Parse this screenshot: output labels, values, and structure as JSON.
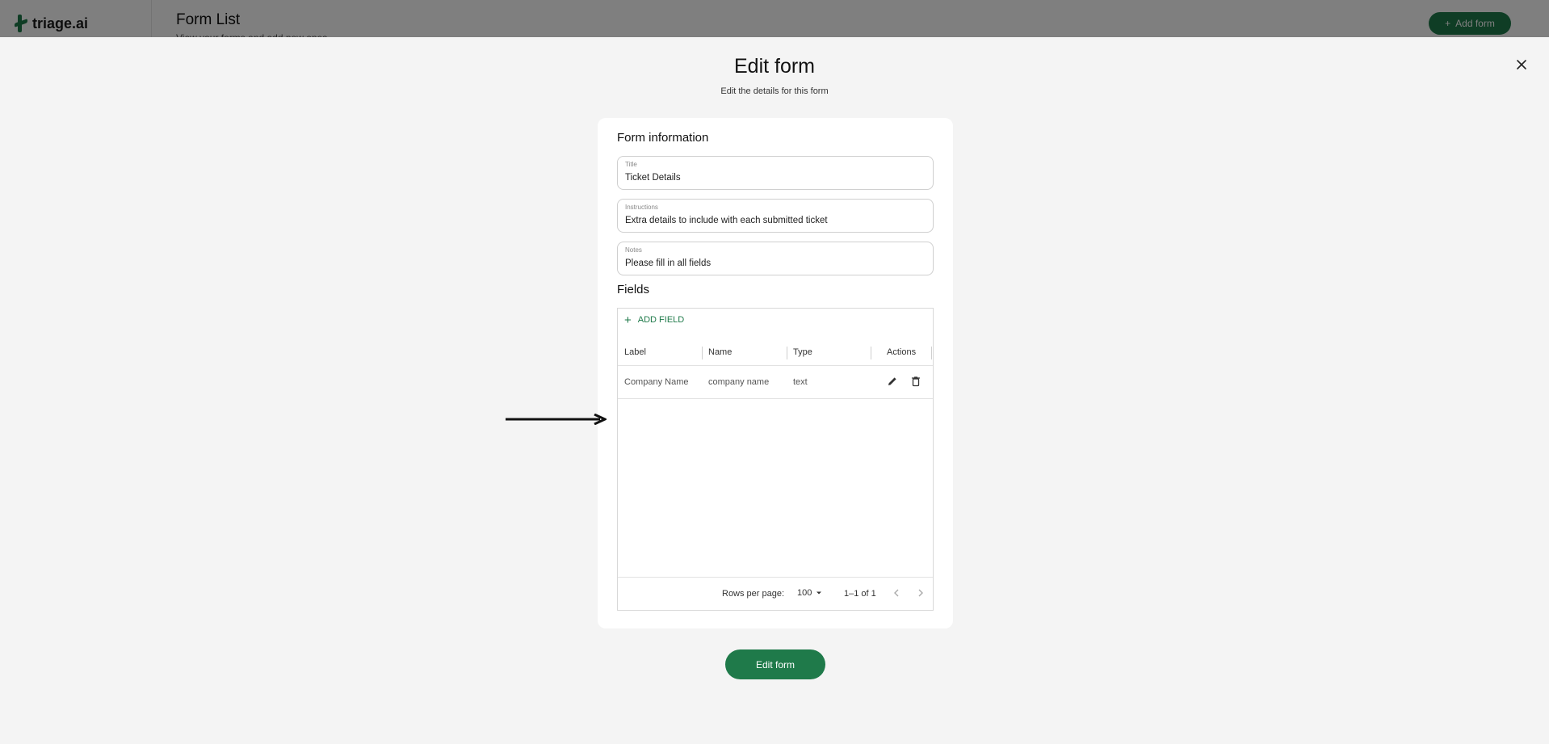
{
  "app": {
    "logo_text": "triage.ai",
    "page_title": "Form List",
    "page_subtitle": "View your forms and add new ones",
    "add_form_label": "Add form"
  },
  "modal": {
    "title": "Edit form",
    "subtitle": "Edit the details for this form",
    "form_info_heading": "Form information",
    "inputs": {
      "title": {
        "label": "Title",
        "value": "Ticket Details"
      },
      "instructions": {
        "label": "Instructions",
        "value": "Extra details to include with each submitted ticket"
      },
      "notes": {
        "label": "Notes",
        "value": "Please fill in all fields"
      }
    },
    "fields_heading": "Fields",
    "add_field_label": "ADD FIELD",
    "columns": {
      "label": "Label",
      "name": "Name",
      "type": "Type",
      "actions": "Actions"
    },
    "rows": [
      {
        "label": "Company Name",
        "name": "company name",
        "type": "text"
      }
    ],
    "pagination": {
      "rows_per_page_label": "Rows per page:",
      "rows_per_page_value": "100",
      "range": "1–1 of 1"
    },
    "submit_label": "Edit form"
  },
  "icons": {
    "close": "close-icon",
    "plus": "plus-icon",
    "edit": "pencil-icon",
    "delete": "trash-icon",
    "prev": "chevron-left-icon",
    "next": "chevron-right-icon",
    "dropdown": "caret-down-icon",
    "pointer": "arrow-right-icon"
  },
  "colors": {
    "accent": "#1f7a4a",
    "overlay": "#7b7b7b",
    "sheet": "#f4f4f4"
  }
}
